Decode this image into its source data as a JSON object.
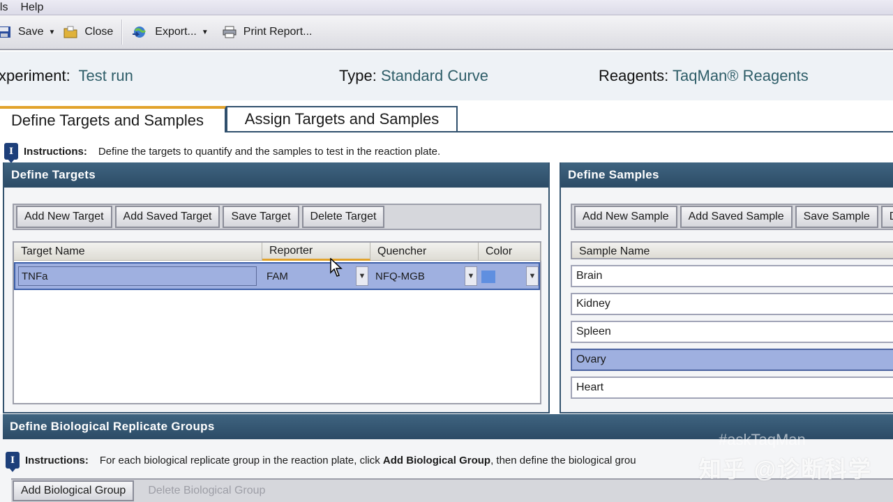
{
  "menu": {
    "items": [
      "ols",
      "Help"
    ]
  },
  "toolbar": {
    "save": "Save",
    "close": "Close",
    "export": "Export...",
    "print": "Print Report..."
  },
  "experiment": {
    "name_label": "xperiment:",
    "name_value": "Test run",
    "type_label": "Type:",
    "type_value": "Standard Curve",
    "reagents_label": "Reagents:",
    "reagents_value": "TaqMan® Reagents"
  },
  "tabs": [
    {
      "label": "Define Targets and Samples",
      "active": true
    },
    {
      "label": "Assign Targets and Samples",
      "active": false
    }
  ],
  "instructions": {
    "label": "Instructions:",
    "text": "Define the targets to quantify and the samples to test in the reaction plate."
  },
  "targets": {
    "title": "Define Targets",
    "buttons": [
      "Add New Target",
      "Add Saved Target",
      "Save Target",
      "Delete Target"
    ],
    "columns": [
      "Target Name",
      "Reporter",
      "Quencher",
      "Color"
    ],
    "rows": [
      {
        "name": "TNFa",
        "reporter": "FAM",
        "quencher": "NFQ-MGB",
        "color": "#5f8fe0"
      }
    ]
  },
  "samples": {
    "title": "Define Samples",
    "buttons": [
      "Add New Sample",
      "Add Saved Sample",
      "Save Sample",
      "D"
    ],
    "column": "Sample Name",
    "rows": [
      "Brain",
      "Kidney",
      "Spleen",
      "Ovary",
      "Heart"
    ],
    "selected_index": 3
  },
  "bio_groups": {
    "title": "Define Biological Replicate Groups",
    "instructions_label": "Instructions:",
    "instructions_prefix": "For each biological replicate group in the reaction plate, click ",
    "instructions_bold": "Add Biological Group",
    "instructions_suffix": ", then define the biological grou",
    "add_button": "Add Biological Group",
    "delete_button": "Delete Biological Group"
  },
  "watermark": {
    "text": "知乎 @诊断科学",
    "faint": "#askTaqMan"
  }
}
